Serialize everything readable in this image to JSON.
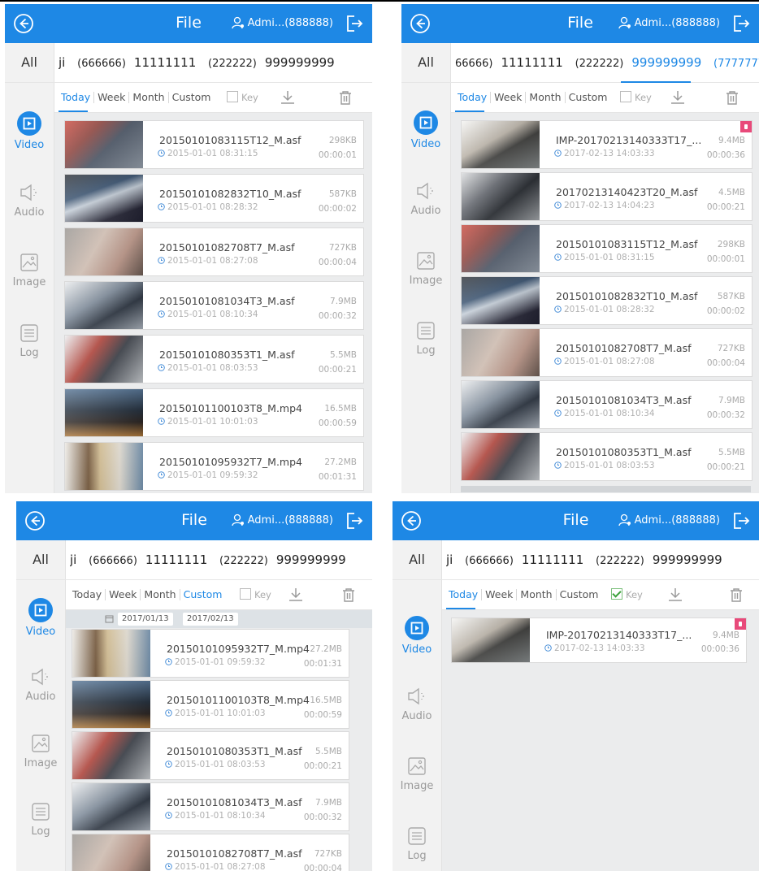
{
  "header": {
    "title": "File",
    "user": "Admi...(888888)"
  },
  "channels_top": {
    "all": "All",
    "items": [
      {
        "id": "ji",
        "name": "",
        "size": ""
      },
      {
        "id": "(666666)",
        "name": "11111111",
        "size": "small"
      },
      {
        "id": "(222222)",
        "name": "999999999",
        "size": "small"
      }
    ]
  },
  "channels_p2": [
    {
      "id": "66666)",
      "name": "11111111"
    },
    {
      "id": "(222222)",
      "name": "999999999"
    },
    {
      "id": "(7777777",
      "name": ""
    }
  ],
  "sidebar": {
    "video": "Video",
    "audio": "Audio",
    "image": "Image",
    "log": "Log"
  },
  "filters": {
    "today": "Today",
    "week": "Week",
    "month": "Month",
    "custom": "Custom",
    "key": "Key"
  },
  "date_range": {
    "from": "2017/01/13",
    "to": "2017/02/13"
  },
  "colors": {
    "accent": "#1e88e5",
    "lock": "#e84a7a",
    "background": "#ebeced"
  },
  "files": {
    "a": {
      "name": "20150101083115T12_M.asf",
      "date": "2015-01-01 08:31:15",
      "size": "298KB",
      "duration": "00:00:01"
    },
    "b": {
      "name": "20150101082832T10_M.asf",
      "date": "2015-01-01 08:28:32",
      "size": "587KB",
      "duration": "00:00:02"
    },
    "c": {
      "name": "20150101082708T7_M.asf",
      "date": "2015-01-01 08:27:08",
      "size": "727KB",
      "duration": "00:00:04"
    },
    "d": {
      "name": "20150101081034T3_M.asf",
      "date": "2015-01-01 08:10:34",
      "size": "7.9MB",
      "duration": "00:00:32"
    },
    "e": {
      "name": "20150101080353T1_M.asf",
      "date": "2015-01-01 08:03:53",
      "size": "5.5MB",
      "duration": "00:00:21"
    },
    "f": {
      "name": "20150101100103T8_M.mp4",
      "date": "2015-01-01 10:01:03",
      "size": "16.5MB",
      "duration": "00:00:59"
    },
    "g": {
      "name": "20150101095932T7_M.mp4",
      "date": "2015-01-01 09:59:32",
      "size": "27.2MB",
      "duration": "00:01:31"
    },
    "h": {
      "name": "IMP-20170213140333T17_...",
      "date": "2017-02-13 14:03:33",
      "size": "9.4MB",
      "duration": "00:00:36"
    },
    "i": {
      "name": "20170213140423T20_M.asf",
      "date": "2017-02-13 14:04:23",
      "size": "4.5MB",
      "duration": "00:00:21"
    }
  }
}
